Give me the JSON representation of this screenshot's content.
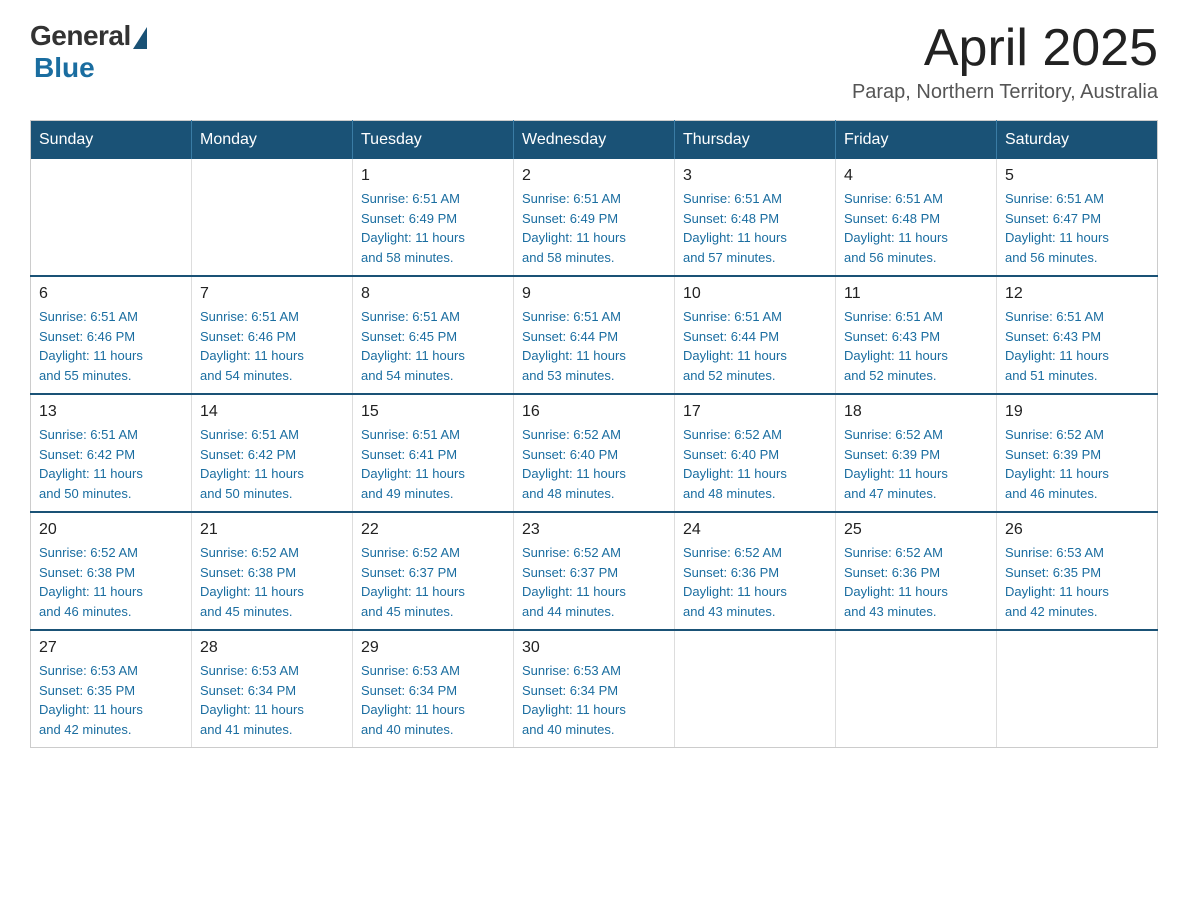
{
  "header": {
    "logo_general": "General",
    "logo_blue": "Blue",
    "month_title": "April 2025",
    "location": "Parap, Northern Territory, Australia"
  },
  "days_of_week": [
    "Sunday",
    "Monday",
    "Tuesday",
    "Wednesday",
    "Thursday",
    "Friday",
    "Saturday"
  ],
  "weeks": [
    [
      {
        "day": "",
        "info": ""
      },
      {
        "day": "",
        "info": ""
      },
      {
        "day": "1",
        "info": "Sunrise: 6:51 AM\nSunset: 6:49 PM\nDaylight: 11 hours\nand 58 minutes."
      },
      {
        "day": "2",
        "info": "Sunrise: 6:51 AM\nSunset: 6:49 PM\nDaylight: 11 hours\nand 58 minutes."
      },
      {
        "day": "3",
        "info": "Sunrise: 6:51 AM\nSunset: 6:48 PM\nDaylight: 11 hours\nand 57 minutes."
      },
      {
        "day": "4",
        "info": "Sunrise: 6:51 AM\nSunset: 6:48 PM\nDaylight: 11 hours\nand 56 minutes."
      },
      {
        "day": "5",
        "info": "Sunrise: 6:51 AM\nSunset: 6:47 PM\nDaylight: 11 hours\nand 56 minutes."
      }
    ],
    [
      {
        "day": "6",
        "info": "Sunrise: 6:51 AM\nSunset: 6:46 PM\nDaylight: 11 hours\nand 55 minutes."
      },
      {
        "day": "7",
        "info": "Sunrise: 6:51 AM\nSunset: 6:46 PM\nDaylight: 11 hours\nand 54 minutes."
      },
      {
        "day": "8",
        "info": "Sunrise: 6:51 AM\nSunset: 6:45 PM\nDaylight: 11 hours\nand 54 minutes."
      },
      {
        "day": "9",
        "info": "Sunrise: 6:51 AM\nSunset: 6:44 PM\nDaylight: 11 hours\nand 53 minutes."
      },
      {
        "day": "10",
        "info": "Sunrise: 6:51 AM\nSunset: 6:44 PM\nDaylight: 11 hours\nand 52 minutes."
      },
      {
        "day": "11",
        "info": "Sunrise: 6:51 AM\nSunset: 6:43 PM\nDaylight: 11 hours\nand 52 minutes."
      },
      {
        "day": "12",
        "info": "Sunrise: 6:51 AM\nSunset: 6:43 PM\nDaylight: 11 hours\nand 51 minutes."
      }
    ],
    [
      {
        "day": "13",
        "info": "Sunrise: 6:51 AM\nSunset: 6:42 PM\nDaylight: 11 hours\nand 50 minutes."
      },
      {
        "day": "14",
        "info": "Sunrise: 6:51 AM\nSunset: 6:42 PM\nDaylight: 11 hours\nand 50 minutes."
      },
      {
        "day": "15",
        "info": "Sunrise: 6:51 AM\nSunset: 6:41 PM\nDaylight: 11 hours\nand 49 minutes."
      },
      {
        "day": "16",
        "info": "Sunrise: 6:52 AM\nSunset: 6:40 PM\nDaylight: 11 hours\nand 48 minutes."
      },
      {
        "day": "17",
        "info": "Sunrise: 6:52 AM\nSunset: 6:40 PM\nDaylight: 11 hours\nand 48 minutes."
      },
      {
        "day": "18",
        "info": "Sunrise: 6:52 AM\nSunset: 6:39 PM\nDaylight: 11 hours\nand 47 minutes."
      },
      {
        "day": "19",
        "info": "Sunrise: 6:52 AM\nSunset: 6:39 PM\nDaylight: 11 hours\nand 46 minutes."
      }
    ],
    [
      {
        "day": "20",
        "info": "Sunrise: 6:52 AM\nSunset: 6:38 PM\nDaylight: 11 hours\nand 46 minutes."
      },
      {
        "day": "21",
        "info": "Sunrise: 6:52 AM\nSunset: 6:38 PM\nDaylight: 11 hours\nand 45 minutes."
      },
      {
        "day": "22",
        "info": "Sunrise: 6:52 AM\nSunset: 6:37 PM\nDaylight: 11 hours\nand 45 minutes."
      },
      {
        "day": "23",
        "info": "Sunrise: 6:52 AM\nSunset: 6:37 PM\nDaylight: 11 hours\nand 44 minutes."
      },
      {
        "day": "24",
        "info": "Sunrise: 6:52 AM\nSunset: 6:36 PM\nDaylight: 11 hours\nand 43 minutes."
      },
      {
        "day": "25",
        "info": "Sunrise: 6:52 AM\nSunset: 6:36 PM\nDaylight: 11 hours\nand 43 minutes."
      },
      {
        "day": "26",
        "info": "Sunrise: 6:53 AM\nSunset: 6:35 PM\nDaylight: 11 hours\nand 42 minutes."
      }
    ],
    [
      {
        "day": "27",
        "info": "Sunrise: 6:53 AM\nSunset: 6:35 PM\nDaylight: 11 hours\nand 42 minutes."
      },
      {
        "day": "28",
        "info": "Sunrise: 6:53 AM\nSunset: 6:34 PM\nDaylight: 11 hours\nand 41 minutes."
      },
      {
        "day": "29",
        "info": "Sunrise: 6:53 AM\nSunset: 6:34 PM\nDaylight: 11 hours\nand 40 minutes."
      },
      {
        "day": "30",
        "info": "Sunrise: 6:53 AM\nSunset: 6:34 PM\nDaylight: 11 hours\nand 40 minutes."
      },
      {
        "day": "",
        "info": ""
      },
      {
        "day": "",
        "info": ""
      },
      {
        "day": "",
        "info": ""
      }
    ]
  ]
}
